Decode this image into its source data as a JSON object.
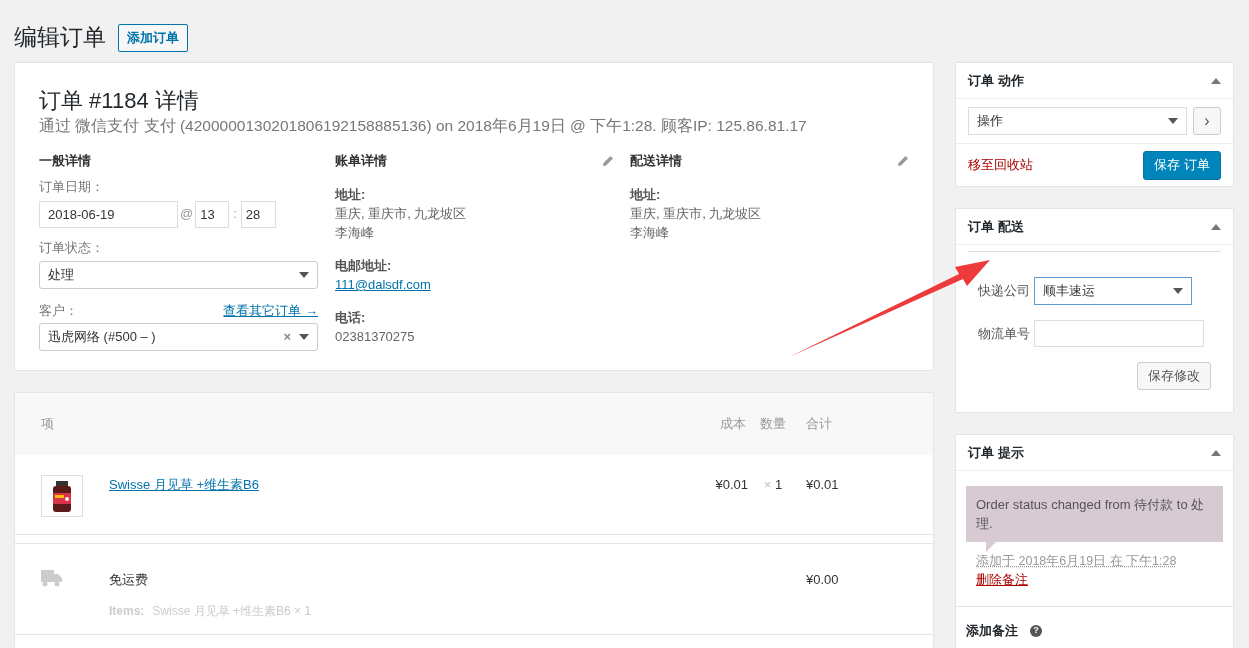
{
  "page_title": "编辑订单",
  "add_button": "添加订单",
  "order": {
    "title": "订单 #1184 详情",
    "subtitle": "通过 微信支付 支付 (4200000130201806192158885136) on 2018年6月19日 @ 下午1:28. 顾客IP: 125.86.81.17",
    "general": {
      "heading": "一般详情",
      "date_label": "订单日期：",
      "date": "2018-06-19",
      "at": "@",
      "hour": "13",
      "colon": ":",
      "minute": "28",
      "status_label": "订单状态：",
      "status": "处理",
      "customer_label": "客户：",
      "customer_link": "查看其它订单 →",
      "customer": "迅虎网络 (#500 – )",
      "clear": "×"
    },
    "billing": {
      "heading": "账单详情",
      "fields": [
        {
          "label": "地址:",
          "lines": [
            "重庆, 重庆市, 九龙坡区",
            "李海峰"
          ]
        },
        {
          "label": "电邮地址:",
          "link": "111@dalsdf.com"
        },
        {
          "label": "电话:",
          "lines": [
            "02381370275"
          ]
        }
      ]
    },
    "shipping": {
      "heading": "配送详情",
      "fields": [
        {
          "label": "地址:",
          "lines": [
            "重庆, 重庆市, 九龙坡区",
            "李海峰"
          ]
        }
      ]
    }
  },
  "items": {
    "columns": [
      "项",
      "成本",
      "数量",
      "合计"
    ],
    "rows": [
      {
        "kind": "product",
        "name": "Swisse 月见草 +维生素B6",
        "cost": "¥0.01",
        "qty_x": "×",
        "qty": "1",
        "total": "¥0.01"
      },
      {
        "kind": "shipping",
        "name": "免运费",
        "meta_label": "Items:",
        "meta": "Swisse 月见草 +维生素B6 × 1",
        "total": "¥0.00"
      }
    ]
  },
  "actions": {
    "title": "订单 动作",
    "select": "操作",
    "go": "›",
    "trash": "移至回收站",
    "save": "保存 订单"
  },
  "delivery": {
    "title": "订单 配送",
    "company_label": "快递公司",
    "company": "顺丰速运",
    "tracking_label": "物流单号",
    "save": "保存修改"
  },
  "notes": {
    "title": "订单 提示",
    "items": [
      {
        "text": "Order status changed from 待付款 to 处理.",
        "meta": "添加于 2018年6月19日 在 下午1:28",
        "delete": "删除备注"
      }
    ],
    "add_title": "添加备注",
    "help": "?"
  }
}
